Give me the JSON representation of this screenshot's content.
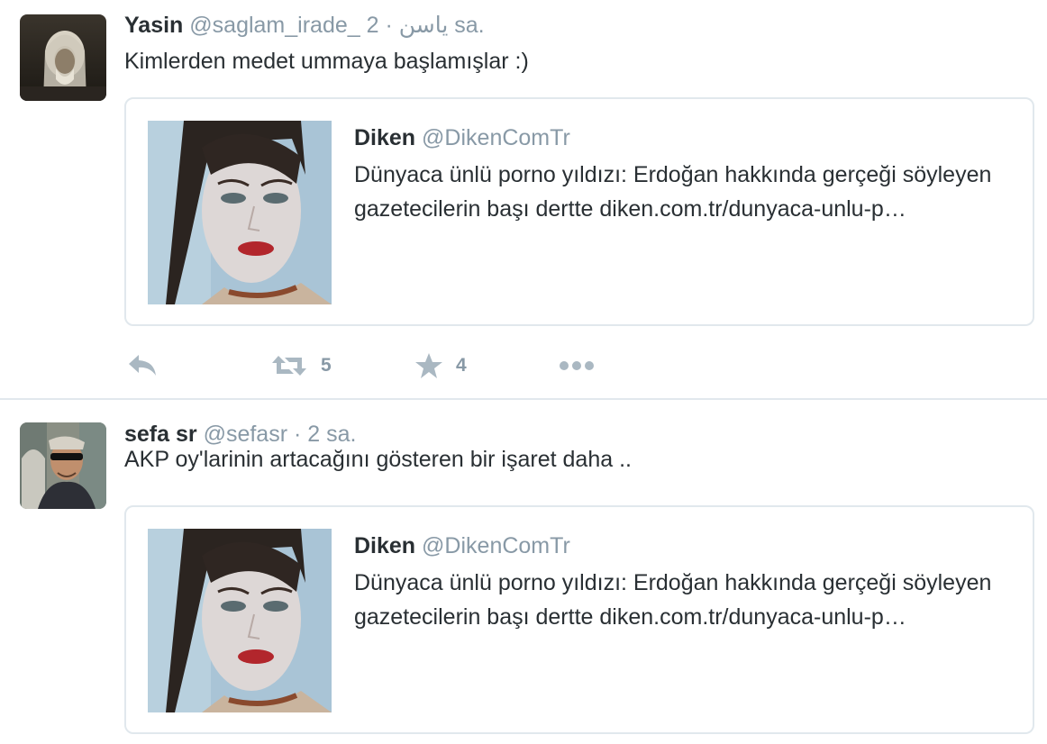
{
  "tweets": [
    {
      "author": {
        "fullname": "Yasin",
        "username": "@saglam_irade_ ياسن",
        "time": "2 sa."
      },
      "separator": "·",
      "text": "Kimlerden medet ummaya başlamışlar :)",
      "quoted": {
        "name": "Diken",
        "handle": "@DikenComTr",
        "text": "Dünyaca ünlü porno yıldızı: Erdoğan hakkında gerçeği söyleyen gazetecilerin başı dertte diken.com.tr/dunyaca-unlu-p…"
      },
      "actions": {
        "reply_icon": "reply-icon",
        "retweet_icon": "retweet-icon",
        "retweet_count": "5",
        "favorite_icon": "star-icon",
        "favorite_count": "4",
        "more_icon": "more-dots-icon"
      }
    },
    {
      "author": {
        "fullname": "sefa sr",
        "username": "@sefasr",
        "time": "2 sa."
      },
      "separator": "·",
      "text": "AKP oy'larinin artacağını gösteren bir işaret daha ..",
      "quoted": {
        "name": "Diken",
        "handle": "@DikenComTr",
        "text": "Dünyaca ünlü porno yıldızı: Erdoğan hakkında gerçeği söyleyen gazetecilerin başı dertte diken.com.tr/dunyaca-unlu-p…"
      }
    }
  ],
  "colors": {
    "text": "#292f33",
    "secondary": "#8899a6",
    "border": "#e1e8ed",
    "icon": "#aab8c2"
  }
}
